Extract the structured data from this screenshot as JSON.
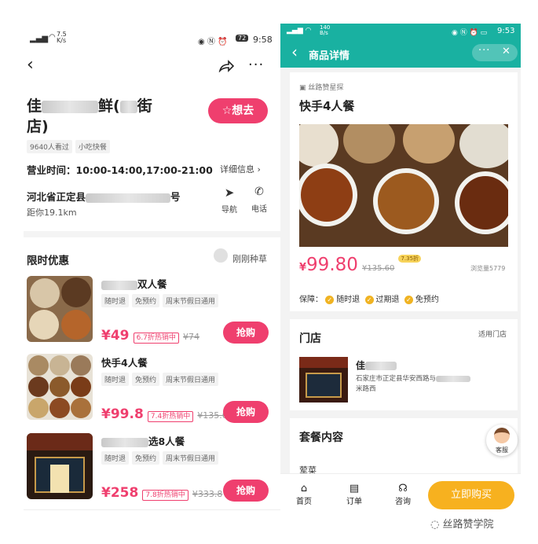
{
  "left": {
    "status": {
      "speed": "7.5",
      "speed_unit": "K/s",
      "battery": "72",
      "time": "9:58"
    },
    "shop_title_1": "佳",
    "shop_title_2": "鲜(",
    "shop_title_3": "街",
    "shop_title_4": "店)",
    "want_label": "想去",
    "tags": [
      "9640人看过",
      "小吃快餐"
    ],
    "hours": "营业时间：10:00-14:00,17:00-21:00",
    "detail_link": "详细信息",
    "address_start": "河北省正定县",
    "address_end": "号",
    "distance": "距你19.1km",
    "nav_label": "导航",
    "phone_label": "电话",
    "section_title": "限时优惠",
    "recent_label": "刚刚种草",
    "deals": [
      {
        "title_start": "",
        "title_end": "双人餐",
        "tags": [
          "随时退",
          "免预约",
          "周末节假日通用"
        ],
        "price": "¥49",
        "discount": "6.7折热销中",
        "old": "¥74",
        "button": "抢购"
      },
      {
        "title_start": "快手4人餐",
        "title_end": "",
        "tags": [
          "随时退",
          "免预约",
          "周末节假日通用"
        ],
        "price": "¥99.8",
        "discount": "7.4折热销中",
        "old": "¥135.6",
        "button": "抢购"
      },
      {
        "title_start": "",
        "title_end": "选8人餐",
        "tags": [
          "随时退",
          "免预约",
          "周末节假日通用"
        ],
        "price": "¥258",
        "discount": "7.8折热销中",
        "old": "¥333.8",
        "button": "抢购"
      }
    ]
  },
  "right": {
    "status": {
      "speed": "140",
      "speed_unit": "B/s",
      "time": "9:53"
    },
    "header_title": "商品详情",
    "brand": "丝路赞星探",
    "product_title": "快手4人餐",
    "price_symbol": "¥",
    "price": "99.80",
    "old_price": "¥135.60",
    "discount_badge": "7.35折",
    "views": "浏览量5779",
    "guarantee_label": "保障：",
    "guarantees": [
      "随时退",
      "过期退",
      "免预约"
    ],
    "store_title": "门店",
    "store_applicable": "适用门店",
    "store_name": "佳",
    "store_address_1": "石家庄市正定县华安西路与",
    "store_address_2": "米路西",
    "package_title": "套餐内容",
    "package_item": "荤菜",
    "service_label": "客服",
    "tabs": [
      "首页",
      "订单",
      "咨询"
    ],
    "buy_button": "立即购买",
    "watermark": "丝路赞学院"
  }
}
